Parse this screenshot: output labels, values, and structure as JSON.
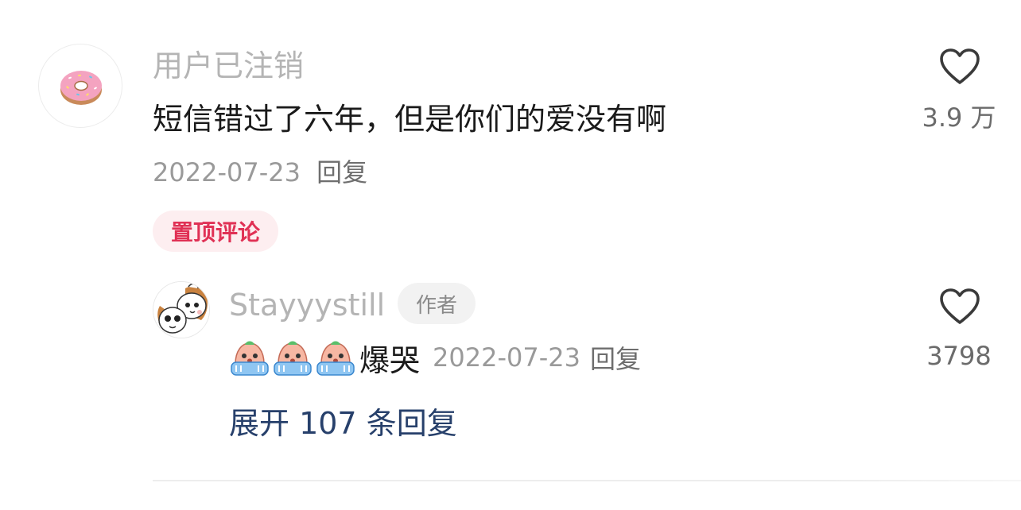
{
  "comment": {
    "username": "用户已注销",
    "text": "短信错过了六年，但是你们的爱没有啊",
    "date": "2022-07-23",
    "reply_label": "回复",
    "pinned_label": "置顶评论",
    "like_count": "3.9 万",
    "avatar_icon": "donut-icon"
  },
  "reply": {
    "username": "Stayyystill",
    "author_badge": "作者",
    "emoji_icon": "crying-emoji-icon",
    "emoji_count": 3,
    "text": "爆哭",
    "date": "2022-07-23",
    "reply_label": "回复",
    "like_count": "3798",
    "avatar_icon": "cartoon-dog-avatar"
  },
  "expand_label": "展开 107 条回复",
  "colors": {
    "pin_text": "#e03155",
    "pin_bg": "#fdeef0",
    "expand_link": "#27406b",
    "muted_text": "#9a9a9a"
  }
}
